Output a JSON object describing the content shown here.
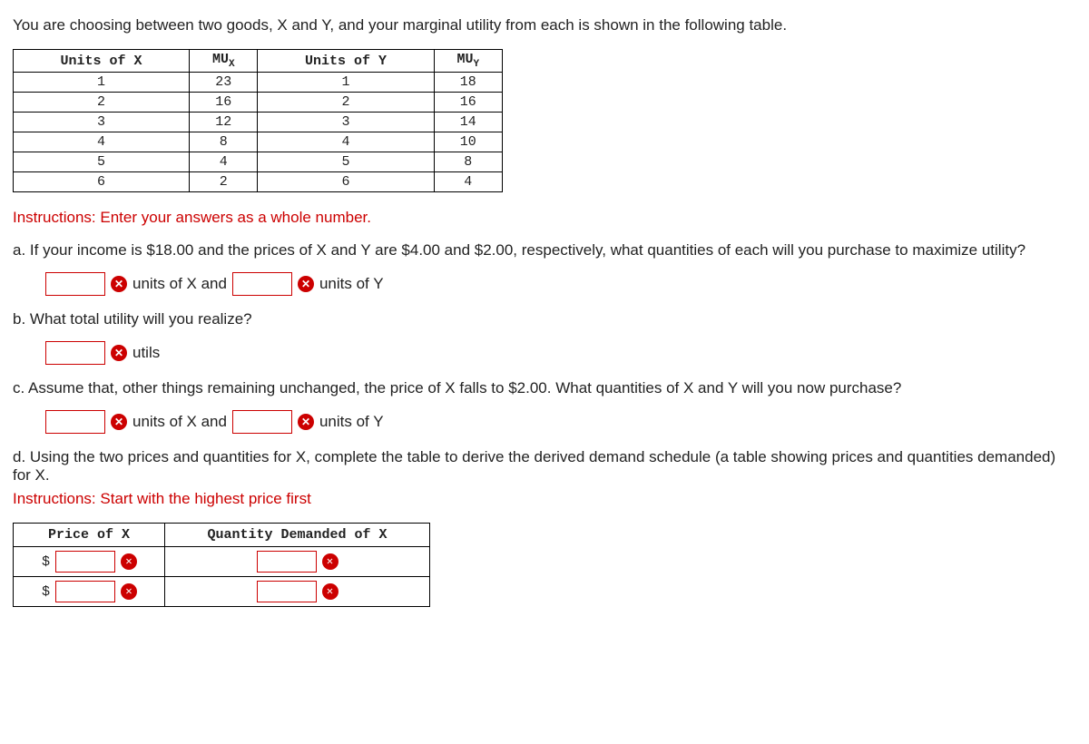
{
  "intro": "You are choosing between two goods, X and Y, and your marginal utility from each is shown in the following table.",
  "table": {
    "headers": {
      "ux": "Units of X",
      "mux": "MU",
      "mux_sub": "X",
      "uy": "Units of Y",
      "muy": "MU",
      "muy_sub": "Y"
    },
    "rows": [
      {
        "ux": "1",
        "mux": "23",
        "uy": "1",
        "muy": "18"
      },
      {
        "ux": "2",
        "mux": "16",
        "uy": "2",
        "muy": "16"
      },
      {
        "ux": "3",
        "mux": "12",
        "uy": "3",
        "muy": "14"
      },
      {
        "ux": "4",
        "mux": "8",
        "uy": "4",
        "muy": "10"
      },
      {
        "ux": "5",
        "mux": "4",
        "uy": "5",
        "muy": "8"
      },
      {
        "ux": "6",
        "mux": "2",
        "uy": "6",
        "muy": "4"
      }
    ]
  },
  "instr": {
    "label": "Instructions:",
    "text": " Enter your answers as a whole number."
  },
  "a": {
    "text": "a. If your income is $18.00 and the prices of X and Y are $4.00 and $2.00, respectively, what quantities of each will you purchase to maximize utility?",
    "units_x": " units of X and ",
    "units_y": " units of Y"
  },
  "b": {
    "text": "b. What total utility will you realize?",
    "utils": " utils"
  },
  "c": {
    "text": "c. Assume that, other things remaining unchanged, the price of X falls to $2.00. What quantities of X and Y will you now purchase?",
    "units_x": " units of X and ",
    "units_y": " units of Y"
  },
  "d": {
    "text": "d. Using the two prices and quantities for X, complete the table to derive the derived demand schedule (a table showing prices and quantities demanded) for X.",
    "instr_label": "Instructions:",
    "instr_text": " Start with the highest price first",
    "headers": {
      "price": "Price of X",
      "qty": "Quantity Demanded of X"
    },
    "dollar": "$"
  }
}
